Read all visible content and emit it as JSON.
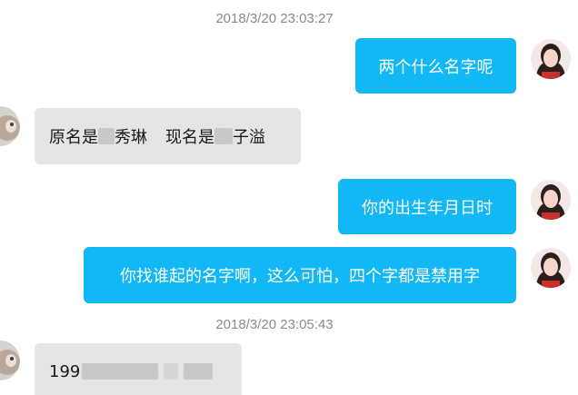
{
  "timestamps": [
    "2018/3/20 23:03:27",
    "2018/3/20 23:05:43"
  ],
  "messages": {
    "m1": "两个什么名字呢",
    "m2": {
      "part1": "原名是",
      "part2": "秀琳",
      "part3": "现名是",
      "part4": "子溢"
    },
    "m3": "你的出生年月日时",
    "m4": "你找谁起的名字啊，这么可怕，四个字都是禁用字",
    "m5": {
      "prefix": "199"
    }
  },
  "colors": {
    "outgoing_bubble": "#12b7f5",
    "incoming_bubble": "#e5e5e5",
    "timestamp_text": "#8a8a8a"
  },
  "icons": {
    "self_avatar": "avatar-woman-icon",
    "other_avatar": "avatar-cat-icon"
  }
}
